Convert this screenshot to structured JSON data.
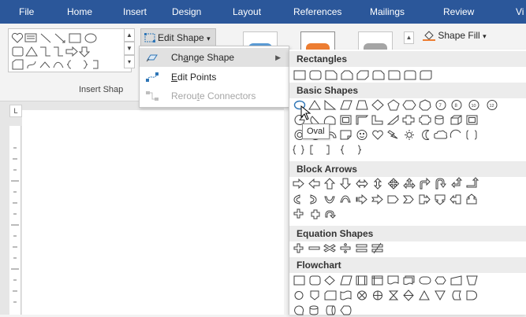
{
  "ribbon": {
    "tabs": [
      "File",
      "Home",
      "Insert",
      "Design",
      "Layout",
      "References",
      "Mailings",
      "Review",
      "Vi"
    ],
    "accent_color": "#2b579a",
    "insert_shapes_group_label": "Insert Shap",
    "edit_shape_label": "Edit Shape",
    "edit_shape_caret": "▾",
    "shape_fill_label": "Shape Fill",
    "shape_fill_caret": "▾",
    "shape_style_colors": [
      "#5b9bd5",
      "#ed7d31",
      "#a5a5a5"
    ],
    "ruler_corner_glyph": "L"
  },
  "edit_shape_menu": {
    "items": [
      {
        "label_pre": "Ch",
        "label_key": "a",
        "label_post": "nge Shape",
        "has_submenu": true,
        "submenu_arrow": "▶",
        "icon": "change-shape-icon"
      },
      {
        "label_pre": "",
        "label_key": "E",
        "label_post": "dit Points",
        "has_submenu": false,
        "icon": "edit-points-icon"
      },
      {
        "label_pre": "Rerou",
        "label_key": "t",
        "label_post": "e Connectors",
        "has_submenu": false,
        "disabled": true,
        "icon": "reroute-connectors-icon"
      }
    ]
  },
  "shapes_flyout": {
    "categories": {
      "rectangles": "Rectangles",
      "basic_shapes": "Basic Shapes",
      "block_arrows": "Block Arrows",
      "equation_shapes": "Equation Shapes",
      "flowchart": "Flowchart"
    }
  },
  "tooltip": {
    "text": "Oval"
  }
}
